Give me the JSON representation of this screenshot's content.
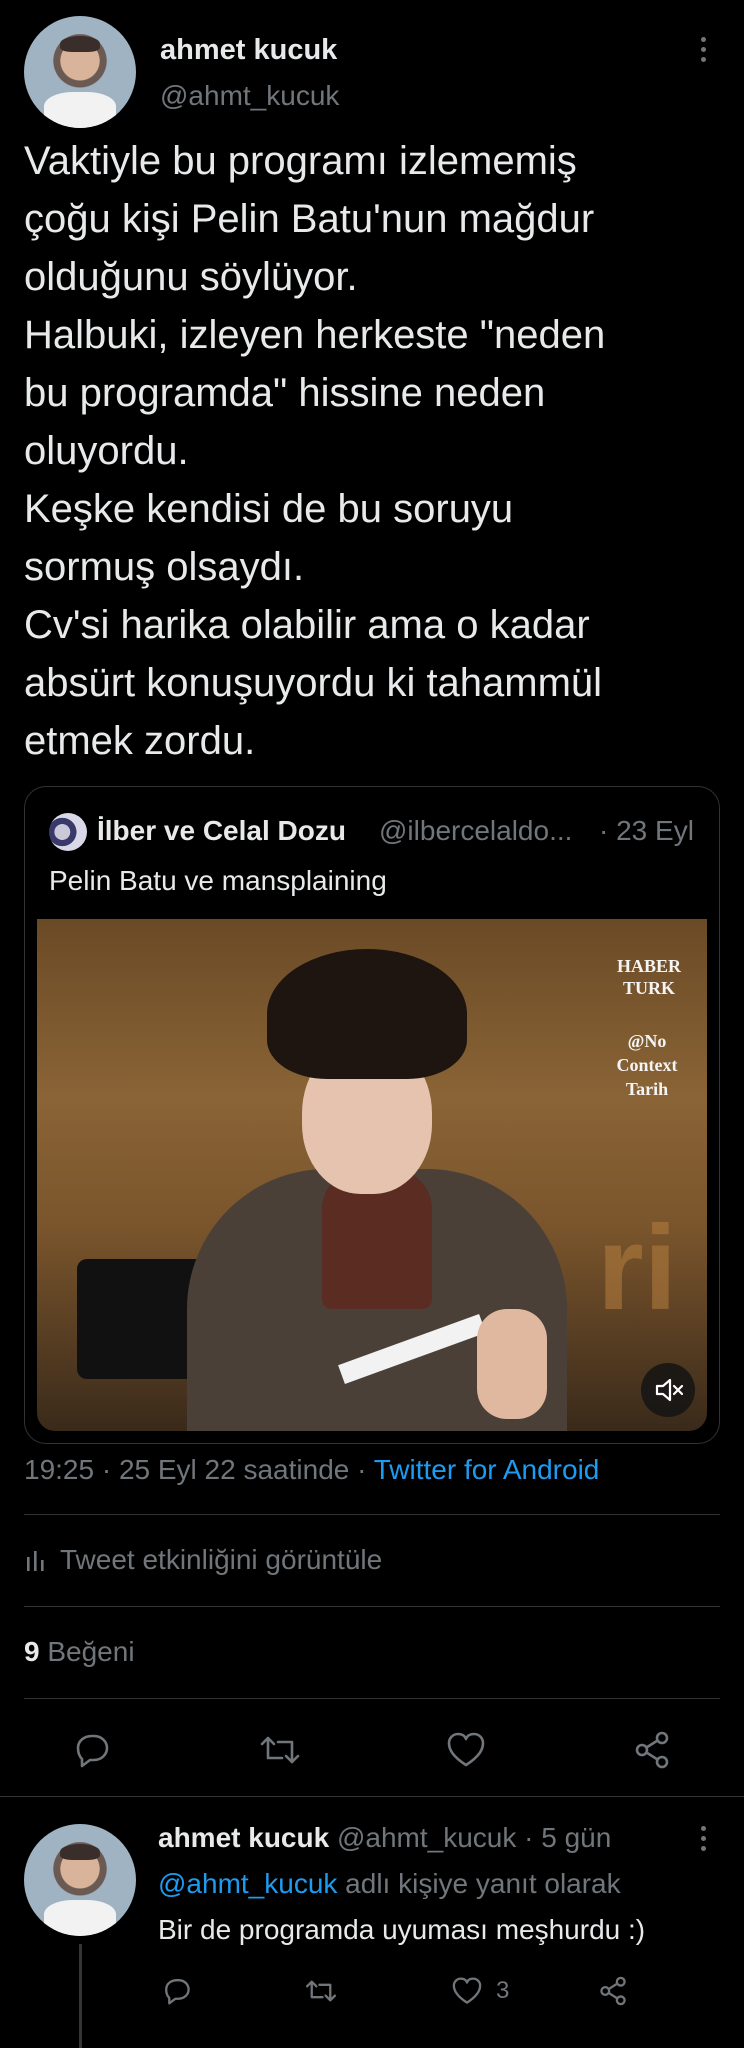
{
  "tweet": {
    "author_name": "ahmet kucuk",
    "author_handle": "@ahmt_kucuk",
    "text_lines": [
      "Vaktiyle bu programı izlememiş",
      "çoğu kişi Pelin Batu'nun mağdur",
      "olduğunu söylüyor.",
      "Halbuki, izleyen herkeste \"neden",
      "bu programda\" hissine neden",
      "oluyordu.",
      "Keşke kendisi de bu soruyu",
      "sormuş olsaydı.",
      "Cv'si harika olabilir ama o kadar",
      "absürt konuşuyordu ki tahammül",
      "etmek zordu."
    ],
    "meta_time": "19:25 · 25 Eyl 22 saatinde · ",
    "meta_source": "Twitter for Android",
    "activity_label": "Tweet etkinliğini görüntüle",
    "likes_count": "9",
    "likes_label": "Beğeni"
  },
  "quote": {
    "author_name": "İlber ve Celal Dozu",
    "author_handle": "@ilbercelaldo...",
    "date": "· 23 Eyl",
    "text": "Pelin Batu ve mansplaining",
    "video_watermark_1": "HABER",
    "video_watermark_2": "TURK",
    "video_watermark_3": "@No",
    "video_watermark_4": "Context",
    "video_watermark_5": "Tarih"
  },
  "reply": {
    "author_name": "ahmet kucuk",
    "author_handle": "@ahmt_kucuk",
    "time": "· 5 gün",
    "replying_to_handle": "@ahmt_kucuk",
    "replying_to_suffix": "adlı kişiye yanıt olarak",
    "text": "Bir de programda uyuması meşhurdu :)",
    "like_count": "3"
  },
  "icons": [
    "more-icon",
    "reply-icon",
    "retweet-icon",
    "like-icon",
    "share-icon",
    "mute-icon",
    "analytics-icon"
  ],
  "colors": {
    "accent": "#1d9bf0",
    "background": "#000000",
    "muted": "#71767b",
    "border": "#2f3336"
  }
}
